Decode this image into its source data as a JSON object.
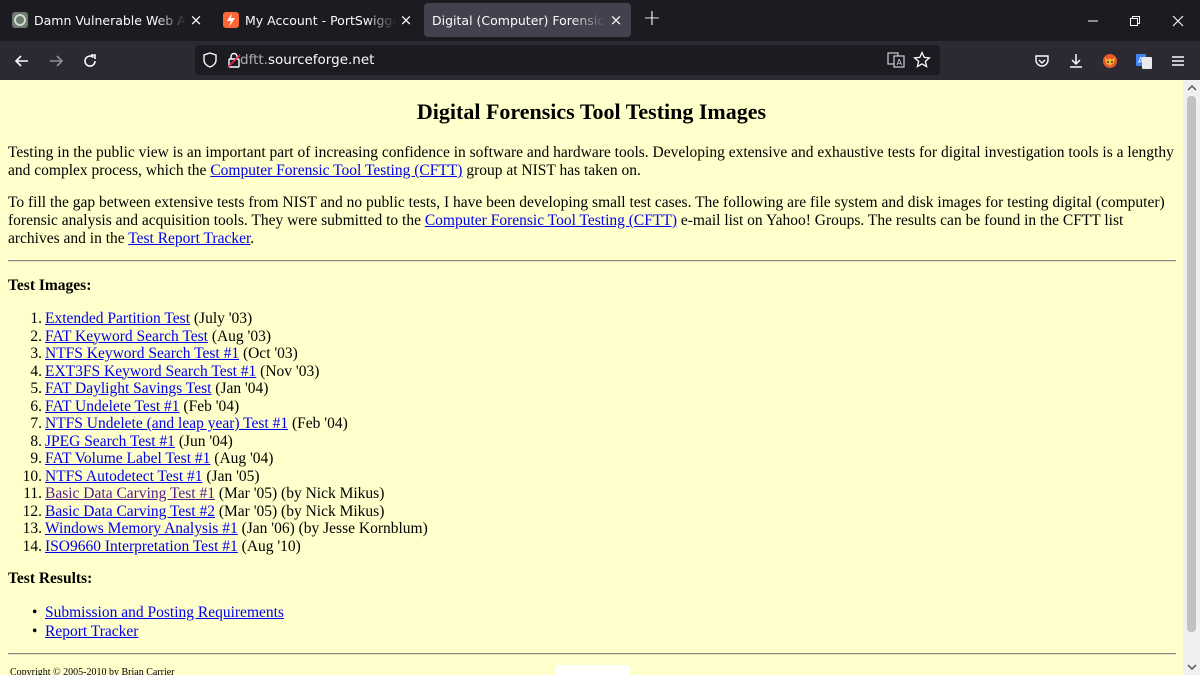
{
  "tabs": [
    {
      "title": "Damn Vulnerable Web App (DVWA)",
      "active": false
    },
    {
      "title": "My Account - PortSwigger",
      "active": false
    },
    {
      "title": "Digital (Computer) Forensics Tool Testing Images",
      "active": true
    }
  ],
  "url": {
    "dim_prefix": "dftt.",
    "domain": "sourceforge.net"
  },
  "page": {
    "heading": "Digital Forensics Tool Testing Images",
    "intro": {
      "before": "Testing in the public view is an important part of increasing confidence in software and hardware tools. Developing extensive and exhaustive tests for digital investigation tools is a lengthy and complex process, which the ",
      "link": "Computer Forensic Tool Testing (CFTT)",
      "after": " group at NIST has taken on."
    },
    "gap": {
      "before": "To fill the gap between extensive tests from NIST and no public tests, I have been developing small test cases. The following are file system and disk images for testing digital (computer) forensic analysis and acquisition tools. They were submitted to the ",
      "link1": "Computer Forensic Tool Testing (CFTT)",
      "middle": " e-mail list on Yahoo! Groups. The results can be found in the CFTT list archives and in the ",
      "link2": "Test Report Tracker",
      "after": "."
    },
    "test_images_heading": "Test Images:",
    "test_images": [
      {
        "n": "1.",
        "link": "Extended Partition Test",
        "note": " (July '03)"
      },
      {
        "n": "2.",
        "link": "FAT Keyword Search Test",
        "note": " (Aug '03)"
      },
      {
        "n": "3.",
        "link": "NTFS Keyword Search Test #1",
        "note": " (Oct '03)"
      },
      {
        "n": "4.",
        "link": "EXT3FS Keyword Search Test #1",
        "note": " (Nov '03)"
      },
      {
        "n": "5.",
        "link": "FAT Daylight Savings Test",
        "note": " (Jan '04)"
      },
      {
        "n": "6.",
        "link": "FAT Undelete Test #1",
        "note": " (Feb '04)"
      },
      {
        "n": "7.",
        "link": "NTFS Undelete (and leap year) Test #1",
        "note": " (Feb '04)"
      },
      {
        "n": "8.",
        "link": "JPEG Search Test #1",
        "note": " (Jun '04)"
      },
      {
        "n": "9.",
        "link": "FAT Volume Label Test #1",
        "note": " (Aug '04)"
      },
      {
        "n": "10.",
        "link": "NTFS Autodetect Test #1",
        "note": " (Jan '05)"
      },
      {
        "n": "11.",
        "link": "Basic Data Carving Test #1",
        "note": " (Mar '05) (by Nick Mikus)"
      },
      {
        "n": "12.",
        "link": "Basic Data Carving Test #2",
        "note": " (Mar '05) (by Nick Mikus)"
      },
      {
        "n": "13.",
        "link": "Windows Memory Analysis #1",
        "note": " (Jan '06) (by Jesse Kornblum)"
      },
      {
        "n": "14.",
        "link": "ISO9660 Interpretation Test #1",
        "note": " (Aug '10)"
      }
    ],
    "test_results_heading": "Test Results:",
    "test_results": [
      {
        "link": "Submission and Posting Requirements"
      },
      {
        "link": "Report Tracker"
      }
    ],
    "copyright": "Copyright © 2005-2010 by Brian Carrier"
  },
  "colors": {
    "link": "#0000ee",
    "visited": "#551a8b",
    "page_bg": "#ffffcc"
  },
  "icons": [
    "back-arrow-icon",
    "forward-arrow-icon",
    "reload-icon",
    "shield-icon",
    "lock-icon",
    "translate-icon",
    "star-icon",
    "pocket-icon",
    "download-icon",
    "extension-fox-icon",
    "extension-translate-icon",
    "menu-icon"
  ]
}
